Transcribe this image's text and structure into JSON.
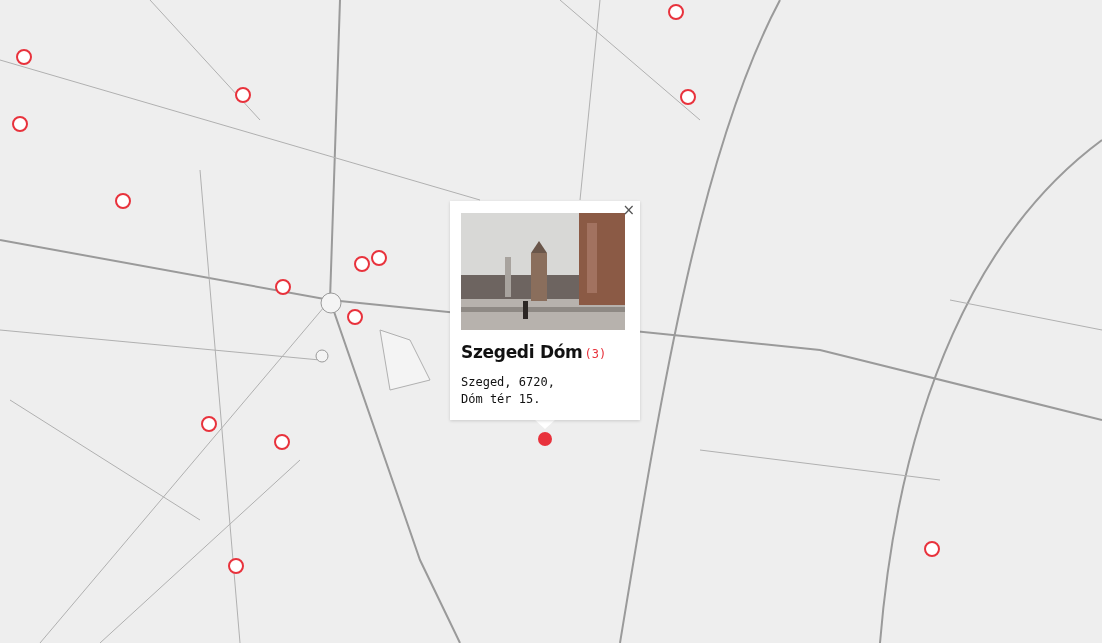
{
  "markers": [
    {
      "selected": false
    },
    {
      "selected": false
    },
    {
      "selected": false
    },
    {
      "selected": false
    },
    {
      "selected": false
    },
    {
      "selected": false
    },
    {
      "selected": false
    },
    {
      "selected": false
    },
    {
      "selected": false
    },
    {
      "selected": false
    },
    {
      "selected": false
    },
    {
      "selected": false
    },
    {
      "selected": false
    },
    {
      "selected": false
    },
    {
      "selected": true
    }
  ],
  "popup": {
    "title": "Szegedi Dóm",
    "count": "(3)",
    "address_lines": [
      "Szeged, 6720,",
      "Dóm tér 15."
    ],
    "close": "×"
  }
}
